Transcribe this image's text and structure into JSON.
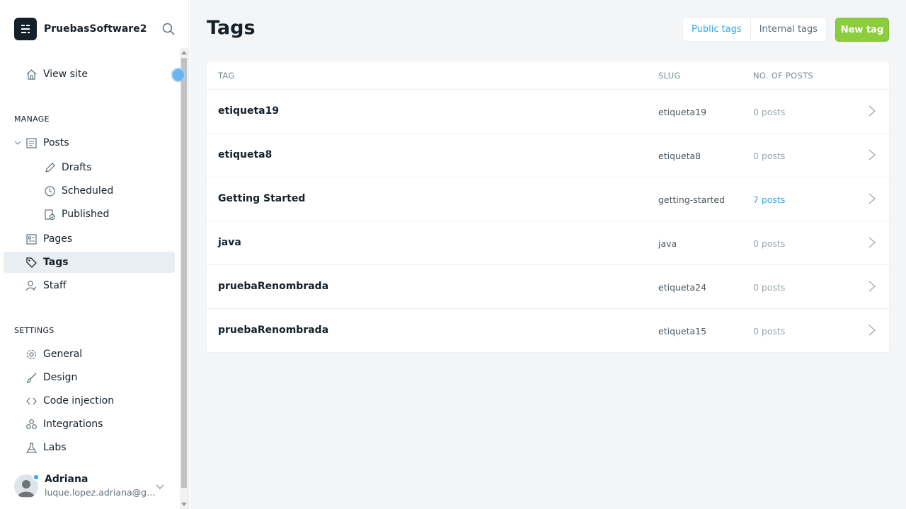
{
  "brand": {
    "name": "PruebasSoftware2"
  },
  "sidebar": {
    "view_site": "View site",
    "manage_label": "MANAGE",
    "posts": "Posts",
    "drafts": "Drafts",
    "scheduled": "Scheduled",
    "published": "Published",
    "pages": "Pages",
    "tags": "Tags",
    "staff": "Staff",
    "settings_label": "SETTINGS",
    "general": "General",
    "design": "Design",
    "code_injection": "Code injection",
    "integrations": "Integrations",
    "labs": "Labs"
  },
  "user": {
    "name": "Adriana",
    "email": "luque.lopez.adriana@gm..."
  },
  "main": {
    "title": "Tags",
    "public_tab": "Public tags",
    "internal_tab": "Internal tags",
    "new_tag": "New tag"
  },
  "table": {
    "headers": {
      "tag": "TAG",
      "slug": "SLUG",
      "posts": "NO. OF POSTS"
    },
    "rows": [
      {
        "name": "etiqueta19",
        "slug": "etiqueta19",
        "posts": "0 posts"
      },
      {
        "name": "etiqueta8",
        "slug": "etiqueta8",
        "posts": "0 posts"
      },
      {
        "name": "Getting Started",
        "slug": "getting-started",
        "posts": "7 posts"
      },
      {
        "name": "java",
        "slug": "java",
        "posts": "0 posts"
      },
      {
        "name": "pruebaRenombrada",
        "slug": "etiqueta24",
        "posts": "0 posts"
      },
      {
        "name": "pruebaRenombrada",
        "slug": "etiqueta15",
        "posts": "0 posts"
      }
    ]
  },
  "colors": {
    "accent": "#30a7ee",
    "primary_button": "#8ccd3e",
    "active_nav": "#e9eef2"
  }
}
